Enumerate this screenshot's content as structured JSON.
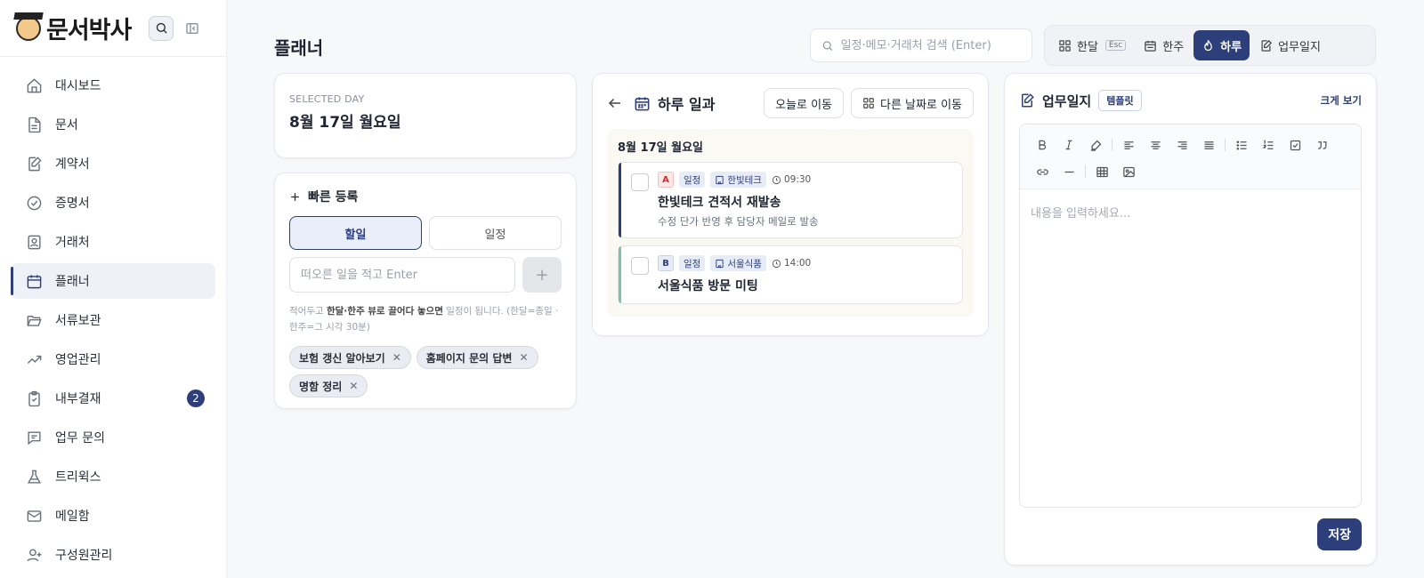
{
  "app": {
    "name": "문서박사"
  },
  "sidebar": {
    "items": [
      {
        "label": "대시보드",
        "icon": "home-icon"
      },
      {
        "label": "문서",
        "icon": "document-icon"
      },
      {
        "label": "계약서",
        "icon": "contract-edit-icon"
      },
      {
        "label": "증명서",
        "icon": "check-circle-icon"
      },
      {
        "label": "거래처",
        "icon": "contact-card-icon"
      },
      {
        "label": "플래너",
        "icon": "calendar-icon",
        "active": true
      },
      {
        "label": "서류보관",
        "icon": "folder-open-icon"
      },
      {
        "label": "영업관리",
        "icon": "trend-up-icon"
      },
      {
        "label": "내부결재",
        "icon": "clipboard-check-icon",
        "badge": "2"
      },
      {
        "label": "업무 문의",
        "icon": "message-square-icon"
      },
      {
        "label": "트리윅스",
        "icon": "flask-icon"
      },
      {
        "label": "메일함",
        "icon": "mail-icon"
      },
      {
        "label": "구성원관리",
        "icon": "user-plus-icon"
      }
    ]
  },
  "header": {
    "title": "플래너",
    "search_placeholder": "일정·메모·거래처 검색 (Enter)",
    "view_tabs": [
      {
        "label": "한달",
        "icon": "grid-icon",
        "kbd": "Esc"
      },
      {
        "label": "한주",
        "icon": "calendar-week-icon"
      },
      {
        "label": "하루",
        "icon": "flame-icon",
        "active": true
      },
      {
        "label": "업무일지",
        "icon": "journal-edit-icon"
      }
    ]
  },
  "selected": {
    "label": "SELECTED DAY",
    "date": "8월 17일 월요일"
  },
  "quick_add": {
    "title": "빠른 등록",
    "toggle_todo": "할일",
    "toggle_event": "일정",
    "input_placeholder": "떠오른 일을 적고 Enter",
    "add_label": "+",
    "hint_pre": "적어두고 ",
    "hint_bold": "한달·한주 뷰로 끌어다 놓으면",
    "hint_post": " 일정이 됩니다. (한달=종일 · 한주=그 시각 30분)",
    "chips": [
      "보험 갱신 알아보기",
      "홈페이지 문의 답변",
      "명함 정리"
    ]
  },
  "day_view": {
    "title": "하루 일과",
    "today_btn": "오늘로 이동",
    "other_btn": "다른 날짜로 이동",
    "date": "8월 17일 월요일",
    "events": [
      {
        "priority": "A",
        "type": "일정",
        "company": "한빛테크",
        "time": "09:30",
        "title": "한빛테크 견적서 재발송",
        "desc": "수정 단가 반영 후 담당자 메일로 발송"
      },
      {
        "priority": "B",
        "type": "일정",
        "company": "서울식품",
        "time": "14:00",
        "title": "서울식품 방문 미팅",
        "desc": ""
      }
    ]
  },
  "worklog": {
    "title": "업무일지",
    "template_btn": "템플릿",
    "expand_btn": "크게 보기",
    "placeholder": "내용을 입력하세요...",
    "save_btn": "저장"
  },
  "colors": {
    "accent": "#2d3f7a",
    "priority_a": "#c53030",
    "event_b_bar": "#7bc3a2"
  }
}
